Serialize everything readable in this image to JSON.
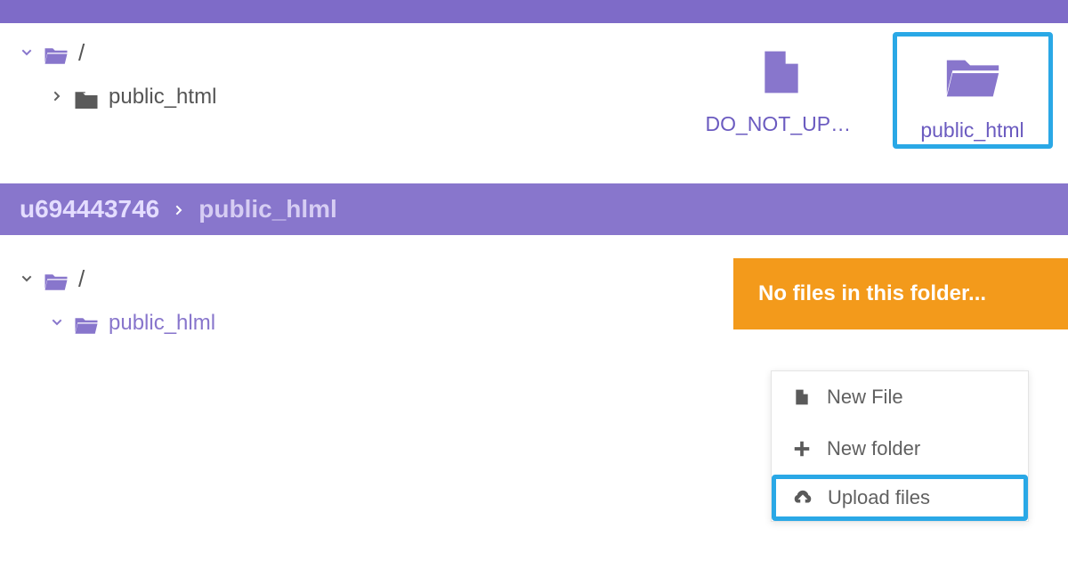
{
  "tree1": {
    "root_slash": "/",
    "child_label": "public_html"
  },
  "grid": {
    "file_label": "DO_NOT_UPLO..",
    "folder_label": "public_html"
  },
  "breadcrumb": {
    "user": "u694443746",
    "current": "public_hlml"
  },
  "tree2": {
    "root_slash": "/",
    "child_label": "public_hlml"
  },
  "empty_banner": "No files in this folder...",
  "context_menu": {
    "new_file": "New File",
    "new_folder": "New folder",
    "upload_files": "Upload files"
  }
}
